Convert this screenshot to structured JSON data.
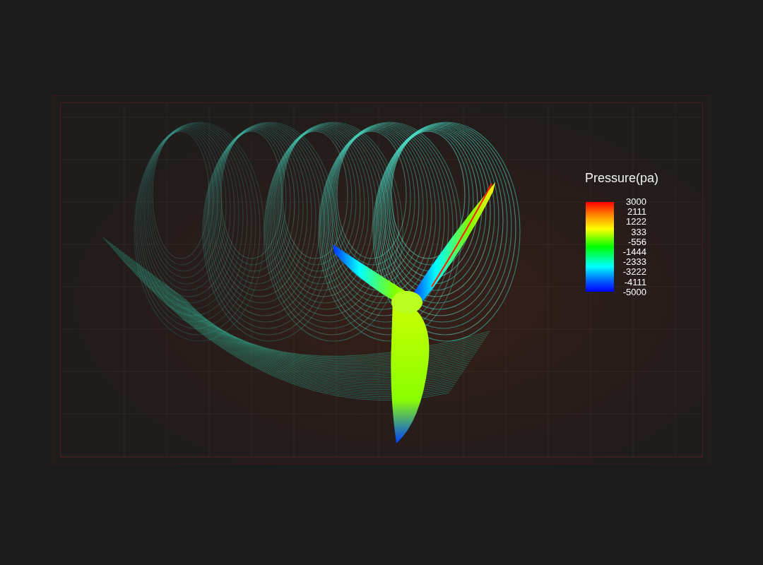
{
  "legend": {
    "title": "Pressure(pa)",
    "labels": [
      "3000",
      "2111",
      "1222",
      "333",
      "-556",
      "-1444",
      "-2333",
      "-3222",
      "-4111",
      "-5000"
    ]
  }
}
